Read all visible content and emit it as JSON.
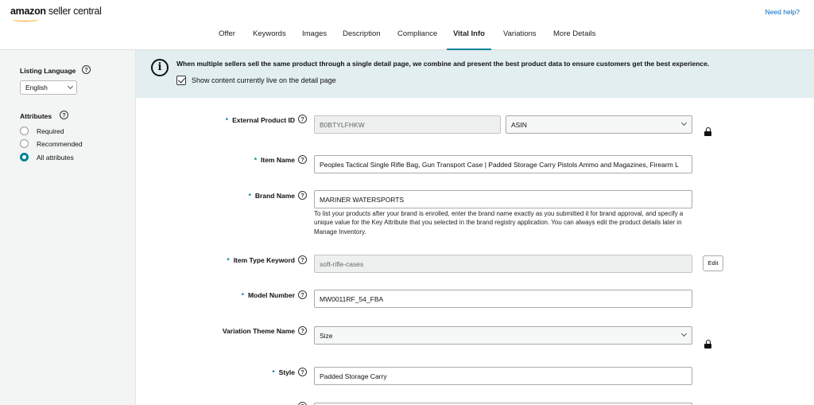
{
  "header": {
    "logo_brand": "amazon",
    "logo_product": " seller central",
    "help_link": "Need help?"
  },
  "tabs": [
    {
      "label": "Offer"
    },
    {
      "label": "Keywords"
    },
    {
      "label": "Images"
    },
    {
      "label": "Description"
    },
    {
      "label": "Compliance"
    },
    {
      "label": "Vital Info",
      "active": true
    },
    {
      "label": "Variations"
    },
    {
      "label": "More Details"
    }
  ],
  "sidebar": {
    "language_label": "Listing Language",
    "language_value": "English",
    "attributes_label": "Attributes",
    "options": [
      {
        "label": "Required",
        "selected": false
      },
      {
        "label": "Recommended",
        "selected": false
      },
      {
        "label": "All attributes",
        "selected": true
      }
    ]
  },
  "banner": {
    "message": "When multiple sellers sell the same product through a single detail page, we combine and present the best product data to ensure customers get the best experience.",
    "checkbox_label": "Show content currently live on the detail page",
    "checked": true
  },
  "form": {
    "external_id": {
      "label": "External Product ID",
      "value": "B0BTYLFHKW",
      "type_value": "ASIN",
      "required": true
    },
    "item_name": {
      "label": "Item Name",
      "value": "Peoples Tactical Single Rifle Bag, Gun Transport Case | Padded Storage Carry Pistols Ammo and Magazines, Firearm L",
      "required": true
    },
    "brand_name": {
      "label": "Brand Name",
      "value": "MARINER WATERSPORTS",
      "required": true,
      "hint": "To list your products after your brand is enrolled, enter the brand name exactly as you submitted it for brand approval, and specify a unique value for the Key Attribute that you selected in the brand registry application. You can always edit the product details later in Manage Inventory."
    },
    "item_type": {
      "label": "Item Type Keyword",
      "value": "soft-rifle-cases",
      "edit_label": "Edit",
      "required": true
    },
    "model_number": {
      "label": "Model Number",
      "value": "MW0011RF_54_FBA",
      "required": true
    },
    "variation_theme": {
      "label": "Variation Theme Name",
      "value": "Size",
      "required": false
    },
    "style": {
      "label": "Style",
      "value": "Padded Storage Carry",
      "required": true
    }
  },
  "icons": {
    "help": "question-circle-icon",
    "lock": "lock-icon",
    "info": "info-circle-icon",
    "chevron": "chevron-down-icon"
  },
  "colors": {
    "accent": "#008296",
    "banner_bg": "#e2eef0",
    "sidebar_bg": "#f3f4f4",
    "link": "#0066c0"
  }
}
